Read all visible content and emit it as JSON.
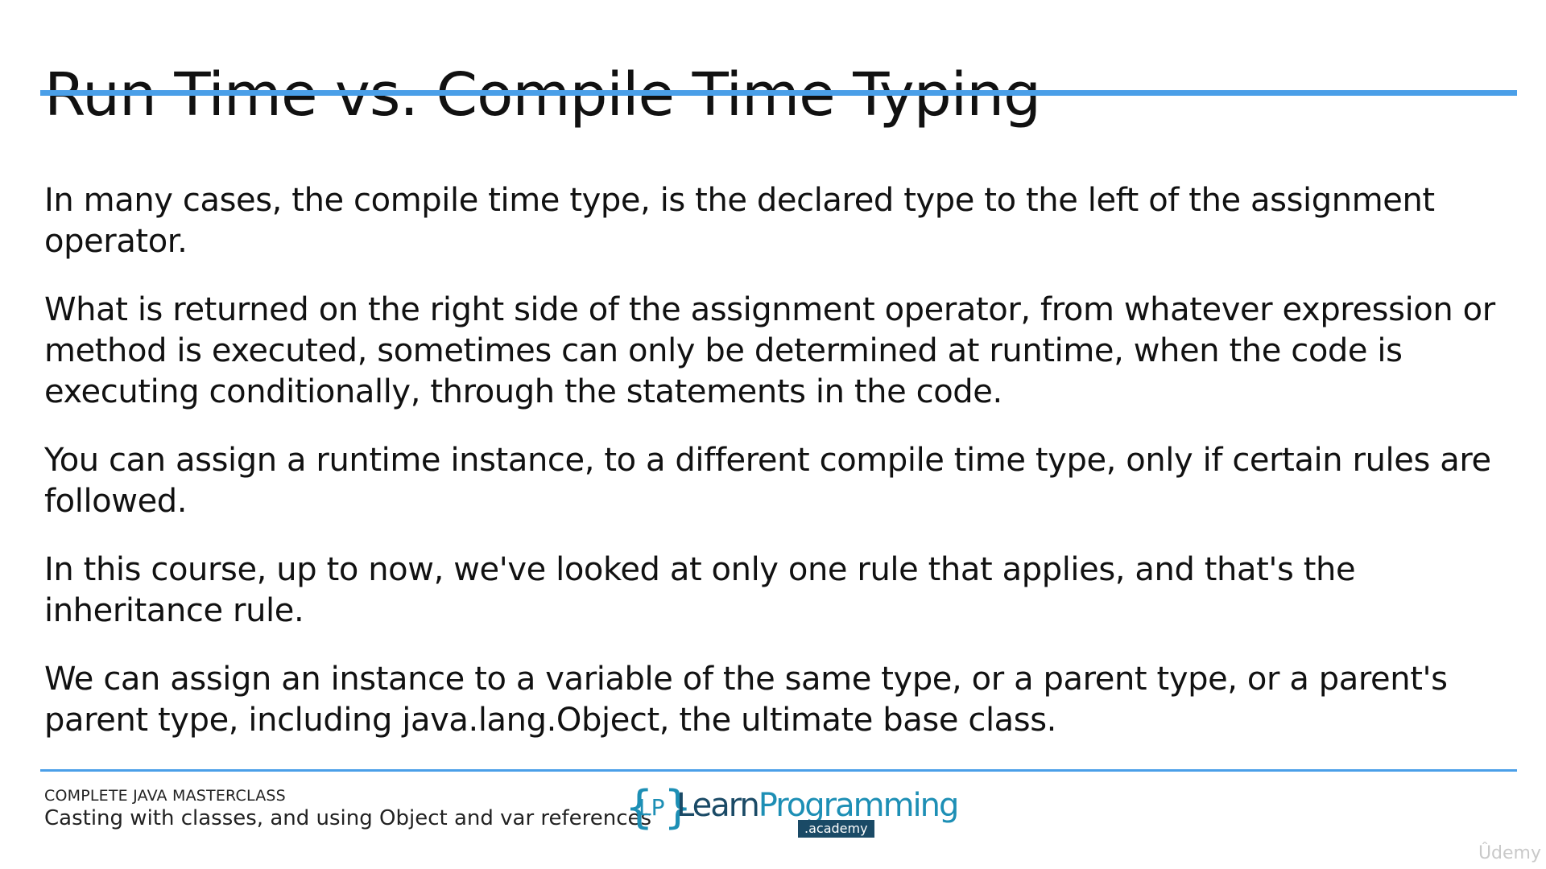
{
  "slide": {
    "title": "Run Time vs. Compile Time Typing",
    "paragraphs": [
      "In many cases, the compile time type, is the declared type to the left of the assignment operator.",
      "What is returned on the right side of the assignment operator, from whatever expression or method is executed, sometimes can only be determined at runtime, when the code is executing conditionally, through the statements in the code.",
      "You can assign a runtime instance, to a different compile time type, only if certain rules are followed.",
      "In this course, up to now, we've looked at only one rule that applies, and that's the inheritance rule.",
      "We can assign an instance to a variable of the same type, or a parent type, or a parent's parent type, including java.lang.Object, the ultimate base class."
    ]
  },
  "footer": {
    "course": "COMPLETE JAVA MASTERCLASS",
    "lesson": "Casting with classes, and using Object and var references"
  },
  "logo": {
    "brace_left": "{",
    "lp": "LP",
    "brace_right": "}",
    "learn": "Learn",
    "programming": "Programming",
    "academy": ".academy"
  },
  "watermark": "Ûdemy",
  "colors": {
    "accent": "#4a9fe8",
    "logo_dark": "#1a4a66",
    "logo_light": "#1d8fb5"
  }
}
